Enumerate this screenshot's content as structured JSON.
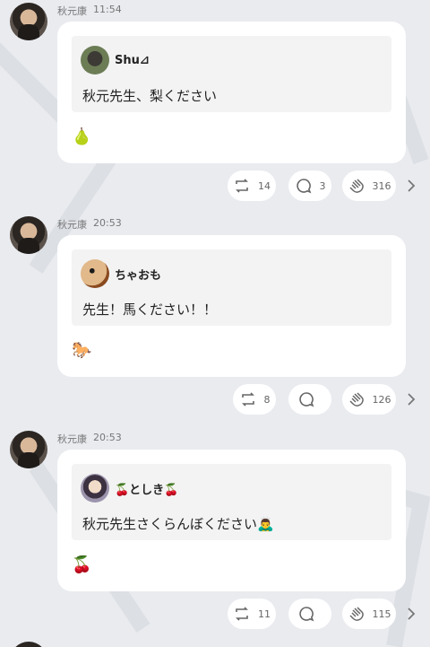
{
  "posts": [
    {
      "author": "秋元康",
      "time": "11:54",
      "quote_user": "Shu⊿",
      "quote_text": "秋元先生、梨ください",
      "reply_emoji": "🍐",
      "retweets": "14",
      "comments": "3",
      "claps": "316",
      "quote_avatar_color": "#5a6b4a"
    },
    {
      "author": "秋元康",
      "time": "20:53",
      "quote_user": "ちゃおも",
      "quote_text": "先生！馬ください！！",
      "reply_emoji": "🐎",
      "retweets": "8",
      "comments": "",
      "claps": "126",
      "quote_avatar_color": "#c07a3a"
    },
    {
      "author": "秋元康",
      "time": "20:53",
      "quote_user": "🍒としき🍒",
      "quote_text": "秋元先生さくらんぼください🙇‍♂️",
      "reply_emoji": "🍒",
      "retweets": "11",
      "comments": "",
      "claps": "115",
      "quote_avatar_color": "#8a7f9c"
    }
  ],
  "colors": {
    "background": "#e9ebef",
    "card": "#ffffff",
    "quote_bg": "#f3f3f3"
  }
}
